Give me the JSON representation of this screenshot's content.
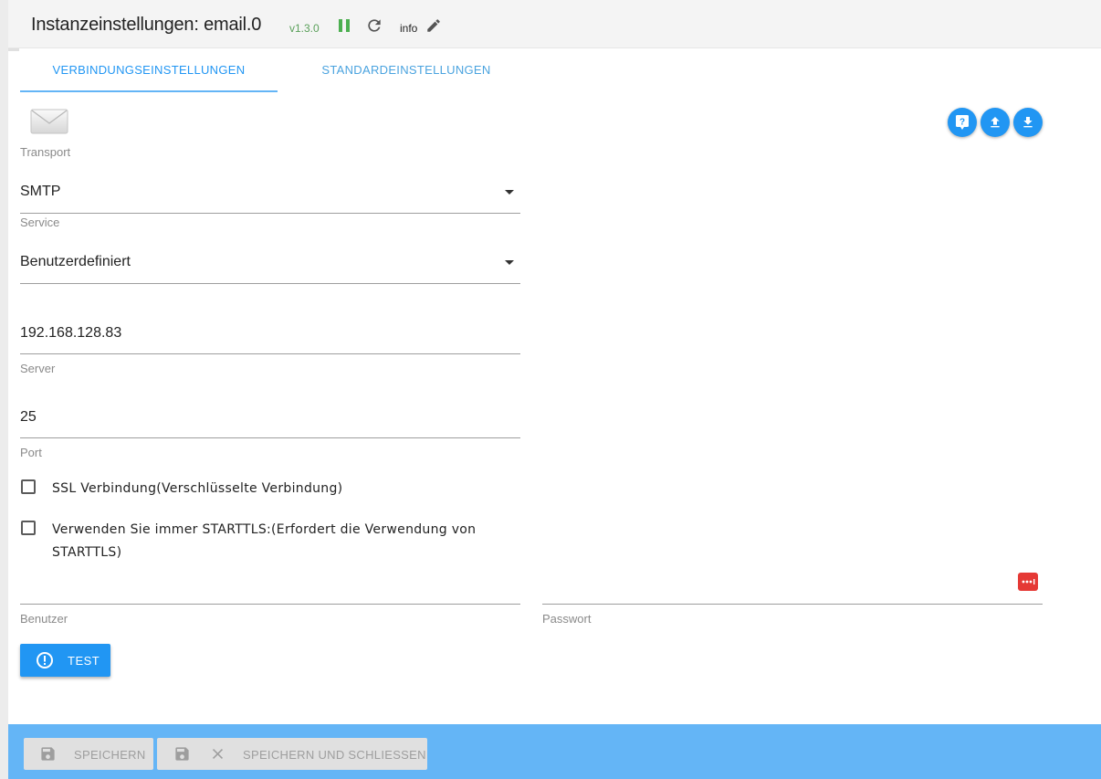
{
  "header": {
    "title": "Instanzeinstellungen: email.0",
    "version": "v1.3.0",
    "info_label": "info"
  },
  "tabs": [
    {
      "label": "VERBINDUNGSEINSTELLUNGEN",
      "active": true
    },
    {
      "label": "STANDARDEINSTELLUNGEN",
      "active": false
    }
  ],
  "form": {
    "transport": {
      "label": "Transport",
      "value": "SMTP"
    },
    "service": {
      "label": "Service",
      "value": "Benutzerdefiniert"
    },
    "server": {
      "label": "Server",
      "value": "192.168.128.83"
    },
    "port": {
      "label": "Port",
      "value": "25"
    },
    "ssl": {
      "label": "SSL Verbindung(Verschlüsselte Verbindung)",
      "checked": false
    },
    "starttls": {
      "label_line1": "Verwenden Sie immer STARTTLS:(Erfordert die Verwendung von",
      "label_line2": "STARTTLS)",
      "checked": false
    },
    "user": {
      "label": "Benutzer",
      "value": ""
    },
    "password": {
      "label": "Passwort",
      "value": ""
    }
  },
  "buttons": {
    "test": "TEST",
    "save": "SPEICHERN",
    "save_close": "SPEICHERN UND SCHLIESSEN"
  },
  "colors": {
    "accent": "#2196f3",
    "footer": "#64b5f6",
    "version": "#5aa05a",
    "password_icon": "#e53935"
  }
}
